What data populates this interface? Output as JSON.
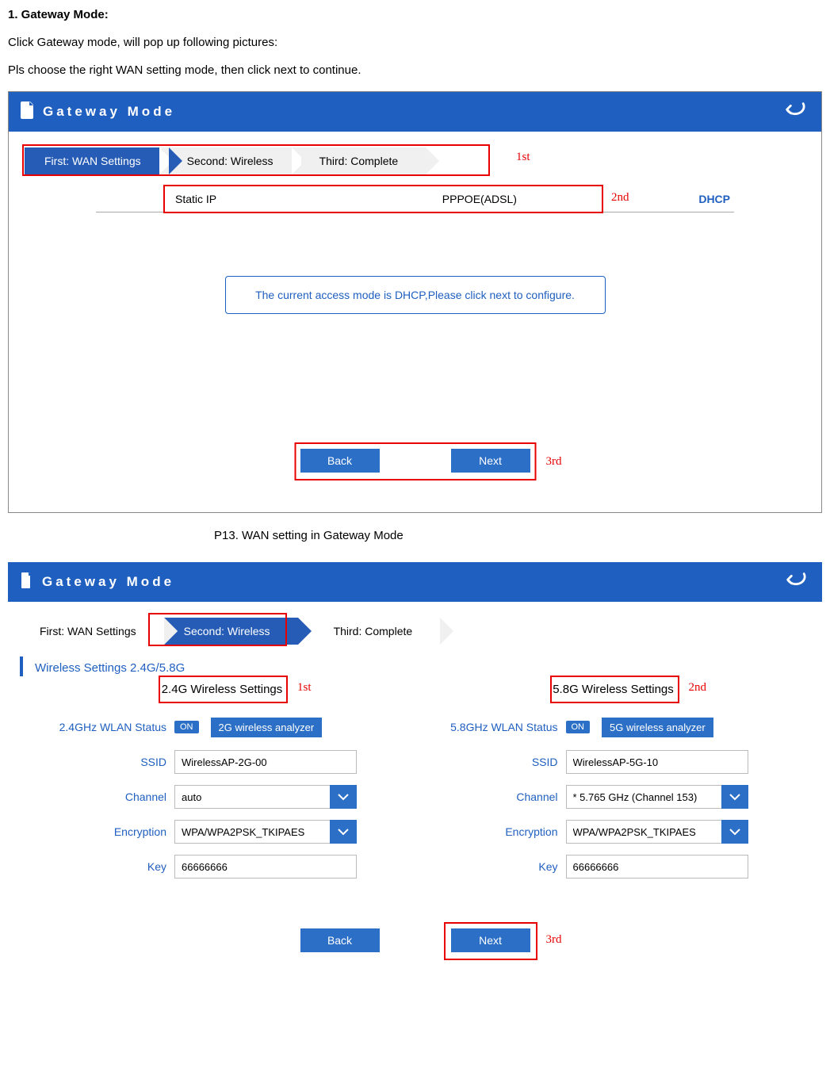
{
  "doc": {
    "heading": "1. Gateway Mode:",
    "para1": "Click Gateway mode, will pop up following pictures:",
    "para2": "Pls choose the right WAN setting mode, then click next to continue.",
    "caption1": "P13. WAN setting in Gateway Mode"
  },
  "annotations": {
    "first": "1st",
    "second": "2nd",
    "third": "3rd"
  },
  "screen1": {
    "header_title": "Gateway Mode",
    "steps": {
      "first": "First: WAN Settings",
      "second": "Second: Wireless",
      "third": "Third: Complete"
    },
    "wan_modes": {
      "static_ip": "Static IP",
      "pppoe": "PPPOE(ADSL)",
      "dhcp": "DHCP"
    },
    "info_text": "The current access mode is DHCP,Please click next to configure.",
    "buttons": {
      "back": "Back",
      "next": "Next"
    }
  },
  "screen2": {
    "header_title": "Gateway Mode",
    "steps": {
      "first": "First: WAN Settings",
      "second": "Second: Wireless",
      "third": "Third: Complete"
    },
    "wireless_heading": "Wireless Settings 2.4G/5.8G",
    "col_24g": {
      "title": "2.4G Wireless Settings",
      "wlan_status_label": "2.4GHz WLAN Status",
      "wlan_status_value": "ON",
      "analyzer": "2G wireless analyzer",
      "ssid_label": "SSID",
      "ssid_value": "WirelessAP-2G-00",
      "channel_label": "Channel",
      "channel_value": "auto",
      "encryption_label": "Encryption",
      "encryption_value": "WPA/WPA2PSK_TKIPAES",
      "key_label": "Key",
      "key_value": "66666666"
    },
    "col_58g": {
      "title": "5.8G Wireless Settings",
      "wlan_status_label": "5.8GHz WLAN Status",
      "wlan_status_value": "ON",
      "analyzer": "5G wireless analyzer",
      "ssid_label": "SSID",
      "ssid_value": "WirelessAP-5G-10",
      "channel_label": "Channel",
      "channel_value": "* 5.765 GHz (Channel 153)",
      "encryption_label": "Encryption",
      "encryption_value": "WPA/WPA2PSK_TKIPAES",
      "key_label": "Key",
      "key_value": "66666666"
    },
    "buttons": {
      "back": "Back",
      "next": "Next"
    }
  }
}
